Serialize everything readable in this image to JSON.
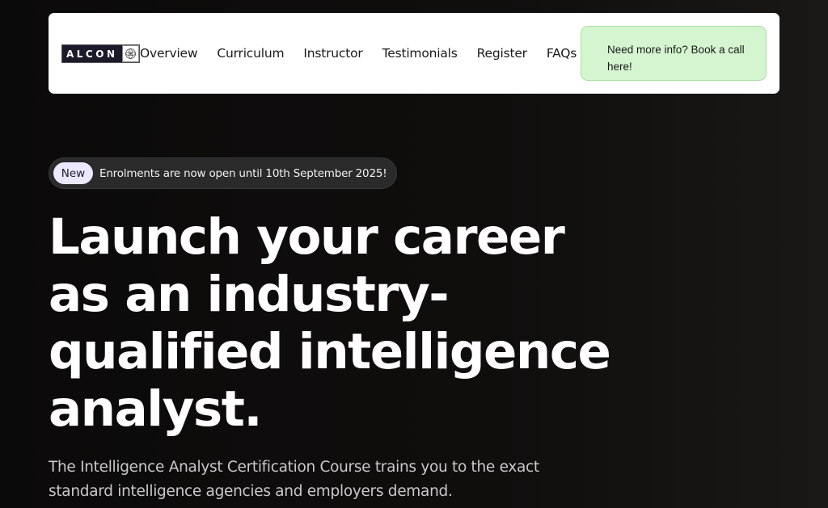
{
  "header": {
    "logo_text": "ALCON",
    "nav": [
      {
        "label": "Overview"
      },
      {
        "label": "Curriculum"
      },
      {
        "label": "Instructor"
      },
      {
        "label": "Testimonials"
      },
      {
        "label": "Register"
      },
      {
        "label": "FAQs"
      }
    ],
    "cta_label": "Need more info? Book a call here!"
  },
  "hero": {
    "badge_label": "New",
    "badge_text": "Enrolments are now open until 10th September 2025!",
    "title_lines": [
      "Launch your career",
      "as an industry-",
      "qualified intelligence",
      "analyst."
    ],
    "subtitle_lines": [
      "The Intelligence Analyst Certification Course trains you to the exact",
      "standard intelligence agencies and employers demand."
    ]
  },
  "colors": {
    "background": "#0b0a0a",
    "cta_bg": "#d4f5d0",
    "badge_pill": "#ebe8ff"
  }
}
